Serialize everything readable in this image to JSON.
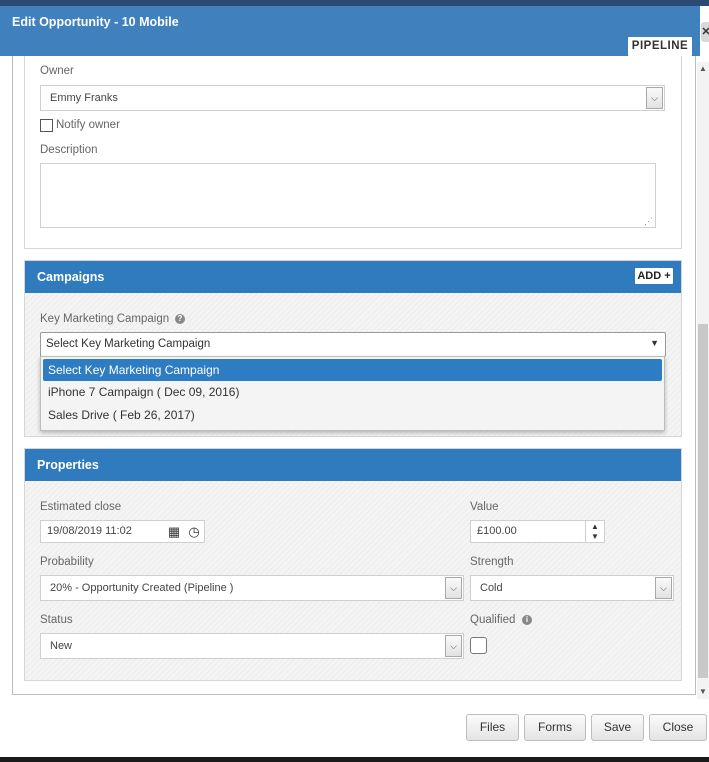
{
  "window": {
    "title": "Edit Opportunity - 10 Mobile",
    "pipeline_label": "PIPELINE",
    "close_icon": "close-icon"
  },
  "owner": {
    "label": "Owner",
    "value": "Emmy Franks",
    "notify_label": "Notify owner",
    "notify_checked": false
  },
  "description": {
    "label": "Description",
    "value": ""
  },
  "campaigns": {
    "title": "Campaigns",
    "add_label": "ADD +",
    "key_label": "Key Marketing Campaign",
    "help_icon": "question-circle-icon",
    "selected": "Select Key Marketing Campaign",
    "options": [
      "Select Key Marketing Campaign",
      "iPhone 7 Campaign ( Dec 09, 2016)",
      "Sales Drive ( Feb 26, 2017)"
    ]
  },
  "properties": {
    "title": "Properties",
    "estimated_close_label": "Estimated close",
    "estimated_close_value": "19/08/2019 11:02",
    "value_label": "Value",
    "value_value": "£100.00",
    "probability_label": "Probability",
    "probability_value": "20% - Opportunity Created (Pipeline )",
    "strength_label": "Strength",
    "strength_value": "Cold",
    "status_label": "Status",
    "status_value": "New",
    "qualified_label": "Qualified",
    "qualified_checked": false
  },
  "footer": {
    "files": "Files",
    "forms": "Forms",
    "save": "Save",
    "close": "Close"
  },
  "colors": {
    "header_blue": "#3f80bd",
    "panel_blue": "#2f7bbd",
    "selected_option": "#2e7dc3"
  }
}
